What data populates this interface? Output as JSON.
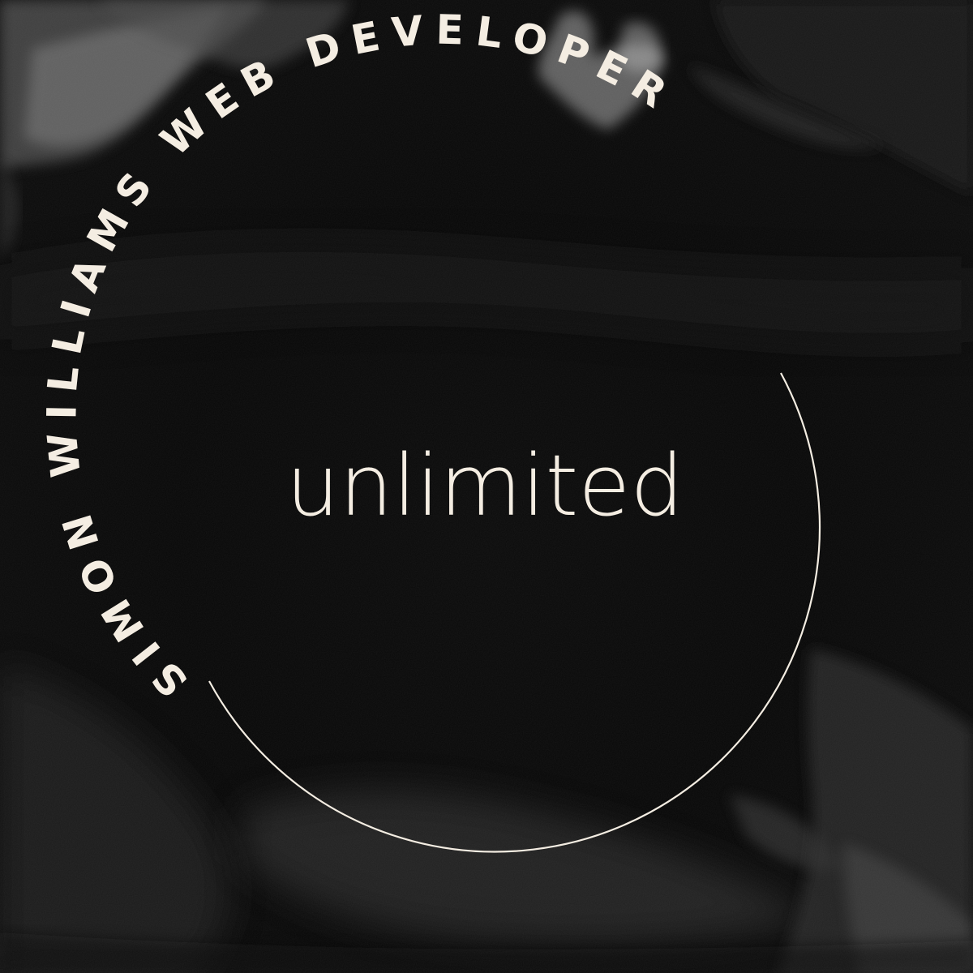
{
  "badge": {
    "arc_text": "SIMON WILLIAMS WEB DEVELOPER",
    "center_word": "unlimited"
  },
  "colors": {
    "background": "#070707",
    "text": "#f4ede2",
    "ring": "#f4ede2"
  }
}
